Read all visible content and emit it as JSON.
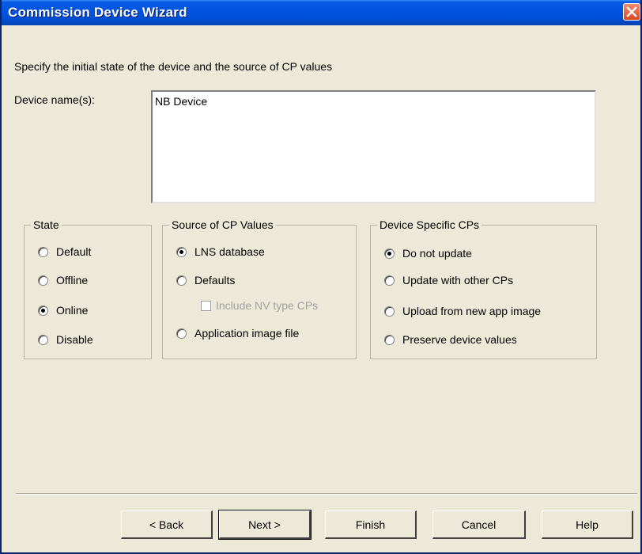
{
  "window": {
    "title": "Commission Device Wizard"
  },
  "instruction": "Specify the initial state of the device and the source of CP values",
  "device_names": {
    "label": "Device name(s):",
    "value": "NB Device"
  },
  "state_group": {
    "legend": "State",
    "options": [
      "Default",
      "Offline",
      "Online",
      "Disable"
    ],
    "selected": "Online"
  },
  "source_group": {
    "legend": "Source of CP Values",
    "options": [
      "LNS database",
      "Defaults",
      "Application image file"
    ],
    "selected": "LNS database",
    "include_nv_checkbox": {
      "label": "Include NV type CPs",
      "checked": false,
      "enabled": false
    }
  },
  "device_cps_group": {
    "legend": "Device Specific CPs",
    "options": [
      "Do not update",
      "Update with other CPs",
      "Upload from new app image",
      "Preserve device values"
    ],
    "selected": "Do not update"
  },
  "buttons": {
    "back": "< Back",
    "next": "Next >",
    "finish": "Finish",
    "cancel": "Cancel",
    "help": "Help"
  }
}
